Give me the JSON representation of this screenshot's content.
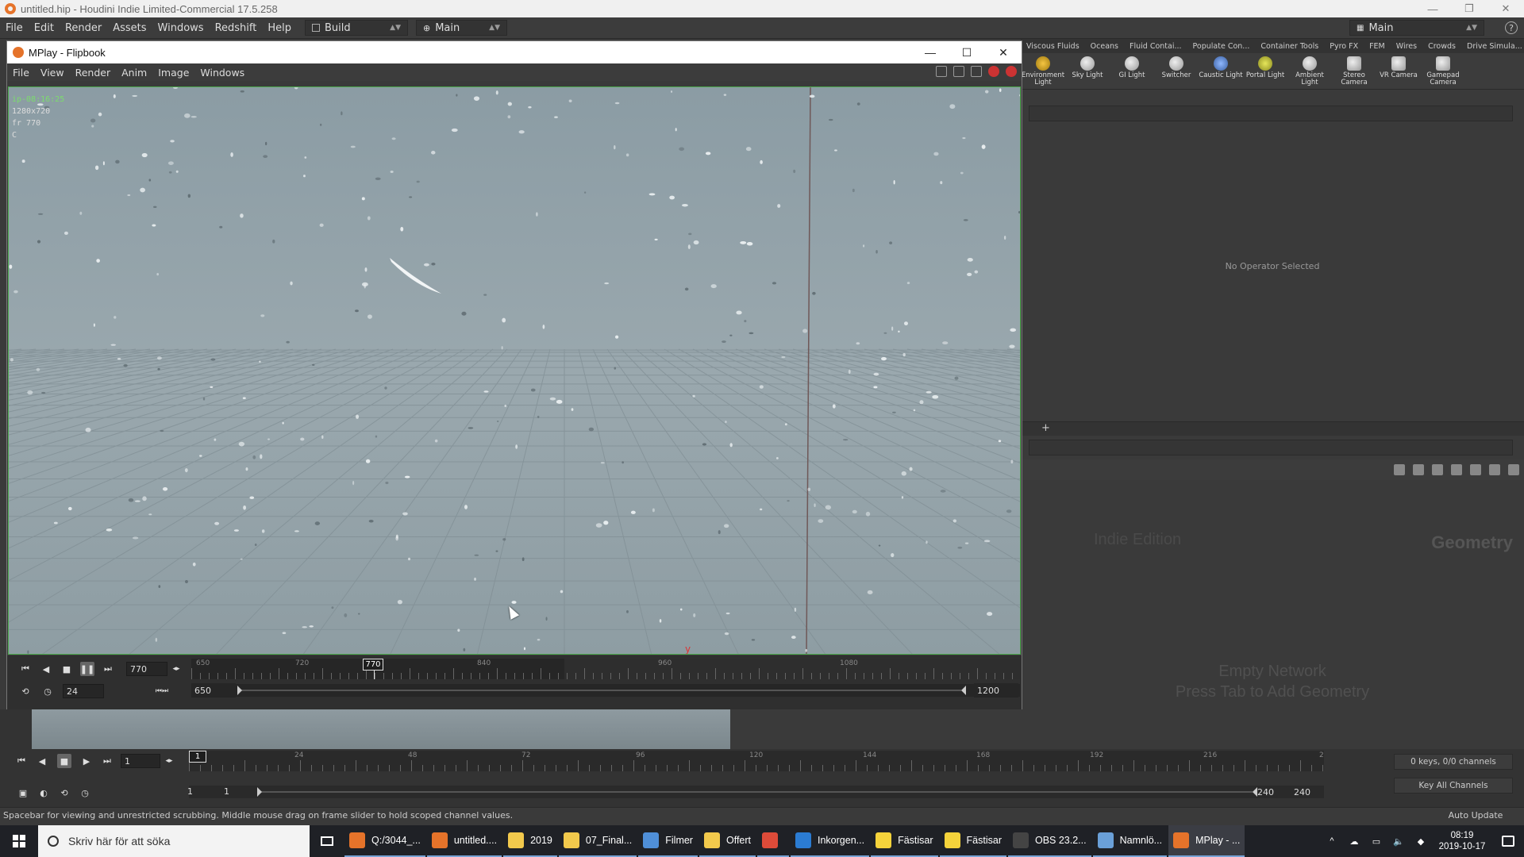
{
  "window": {
    "title": "untitled.hip - Houdini Indie Limited-Commercial 17.5.258",
    "controls": [
      "—",
      "❐",
      "✕"
    ]
  },
  "menubar": {
    "items": [
      "File",
      "Edit",
      "Render",
      "Assets",
      "Windows",
      "Redshift",
      "Help"
    ],
    "build_label": "Build",
    "main_label": "Main",
    "desktop_label": "Main"
  },
  "shelf": {
    "tabs": [
      "Viscous Fluids",
      "Oceans",
      "Fluid Contai...",
      "Populate Con...",
      "Container Tools",
      "Pyro FX",
      "FEM",
      "Wires",
      "Crowds",
      "Drive Simula..."
    ],
    "tools": [
      "Environment Light",
      "Sky Light",
      "GI Light",
      "Switcher",
      "Caustic Light",
      "Portal Light",
      "Ambient Light",
      "Stereo Camera",
      "VR Camera",
      "Gamepad Camera"
    ]
  },
  "params": {
    "no_operator": "No Operator Selected"
  },
  "network": {
    "watermark": "Indie Edition",
    "context": "Geometry",
    "empty_line1": "Empty Network",
    "empty_line2": "Press Tab to Add Geometry"
  },
  "mplay": {
    "title": "MPlay - Flipbook",
    "menu": [
      "File",
      "View",
      "Render",
      "Anim",
      "Image",
      "Windows"
    ],
    "info": {
      "name": "ip-08:16:25",
      "resolution": "1280x720",
      "frame": "fr 770",
      "channel": "C"
    },
    "playbar": {
      "current_frame": "770",
      "fps": "24",
      "range_start": "650",
      "range_end": "1200",
      "ruler_labels": [
        "650",
        "720",
        "840",
        "960",
        "1080"
      ],
      "marker": "770"
    }
  },
  "timeline": {
    "current_frame": "1",
    "ruler_labels": [
      "24",
      "48",
      "72",
      "96",
      "120",
      "144",
      "168",
      "192",
      "216",
      "2"
    ],
    "marker": "1",
    "range_start": "1",
    "range_start2": "1",
    "range_end": "240",
    "range_end2": "240",
    "keys_label": "0 keys, 0/0 channels",
    "key_all_label": "Key All Channels"
  },
  "statusbar": {
    "message": "Spacebar for viewing and unrestricted scrubbing. Middle mouse drag on frame slider to hold scoped channel values.",
    "auto_update": "Auto Update"
  },
  "taskbar": {
    "search_placeholder": "Skriv här för att söka",
    "items": [
      {
        "label": "Q:/3044_...",
        "color": "#e5732a"
      },
      {
        "label": "untitled....",
        "color": "#e5732a"
      },
      {
        "label": "2019",
        "color": "#f2c94c"
      },
      {
        "label": "07_Final...",
        "color": "#f2c94c"
      },
      {
        "label": "Filmer",
        "color": "#4f8fd8"
      },
      {
        "label": "Offert",
        "color": "#f2c94c"
      },
      {
        "label": "",
        "color": "#dd4b39"
      },
      {
        "label": "Inkorgen...",
        "color": "#2b7cd3"
      },
      {
        "label": "Fästisar",
        "color": "#f5d33b"
      },
      {
        "label": "Fästisar",
        "color": "#f5d33b"
      },
      {
        "label": "OBS 23.2...",
        "color": "#444444"
      },
      {
        "label": "Namnlö...",
        "color": "#6aa0d8"
      },
      {
        "label": "MPlay - ...",
        "color": "#e5732a"
      }
    ],
    "time": "08:19",
    "date": "2019-10-17"
  }
}
